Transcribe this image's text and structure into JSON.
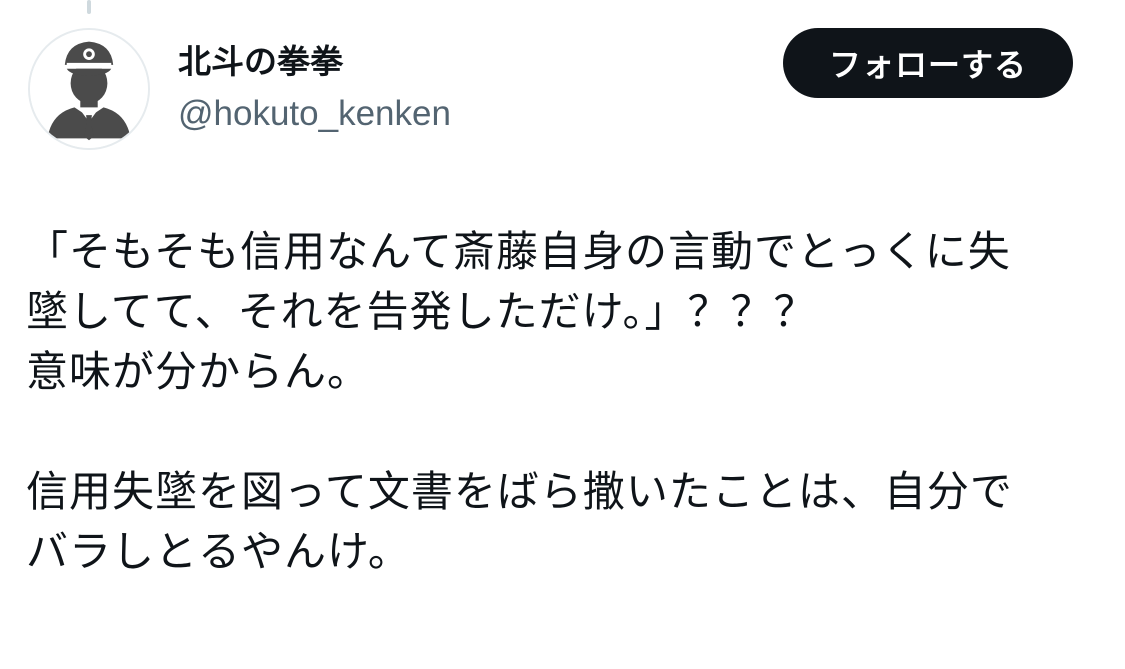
{
  "tweet": {
    "author": {
      "display_name": "北斗の拳拳",
      "handle": "@hokuto_kenken",
      "avatar_icon": "conductor-avatar-icon"
    },
    "follow_button_label": "フォローする",
    "text_lines": [
      "「そもそも信用なんて斎藤自身の言動でとっくに失",
      "墜してて、それを告発しただけ。」？？？",
      "意味が分からん。",
      "",
      "信用失墜を図って文書をばら撒いたことは、自分で",
      "バラしとるやんけ。"
    ],
    "colors": {
      "text": "#0f1419",
      "secondary_text": "#536471",
      "button_background": "#0f1419",
      "button_text": "#ffffff"
    }
  }
}
